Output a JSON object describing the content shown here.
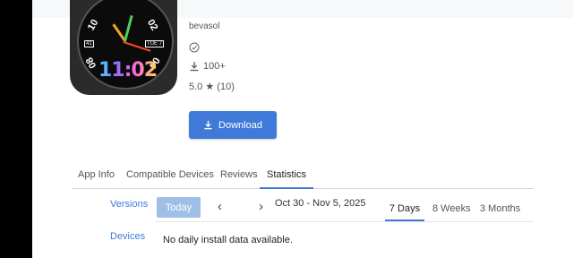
{
  "app": {
    "developer": "bevasol",
    "downloads": "100+",
    "rating": "5.0",
    "rating_count": "(10)",
    "download_label": "Download",
    "watch_time": "11:02",
    "watch_numbers": [
      "10",
      "02",
      "08",
      "04"
    ],
    "watch_boxes": [
      "41",
      "TUE 7"
    ]
  },
  "tabs": [
    {
      "label": "App Info",
      "active": false
    },
    {
      "label": "Compatible Devices",
      "active": false
    },
    {
      "label": "Reviews",
      "active": false
    },
    {
      "label": "Statistics",
      "active": true
    }
  ],
  "stats": {
    "versions_label": "Versions",
    "devices_label": "Devices",
    "today_label": "Today",
    "date_range": "Oct 30 - Nov 5, 2025",
    "periods": [
      "7 Days",
      "8 Weeks",
      "3 Months"
    ],
    "active_period": "7 Days",
    "empty_message": "No daily install data available."
  },
  "colors": {
    "accent": "#3f7ad9",
    "today_disabled": "#9fbfe6"
  },
  "icons": [
    "check-circle-icon",
    "download-icon",
    "star-icon",
    "chevron-left-icon",
    "chevron-right-icon"
  ]
}
